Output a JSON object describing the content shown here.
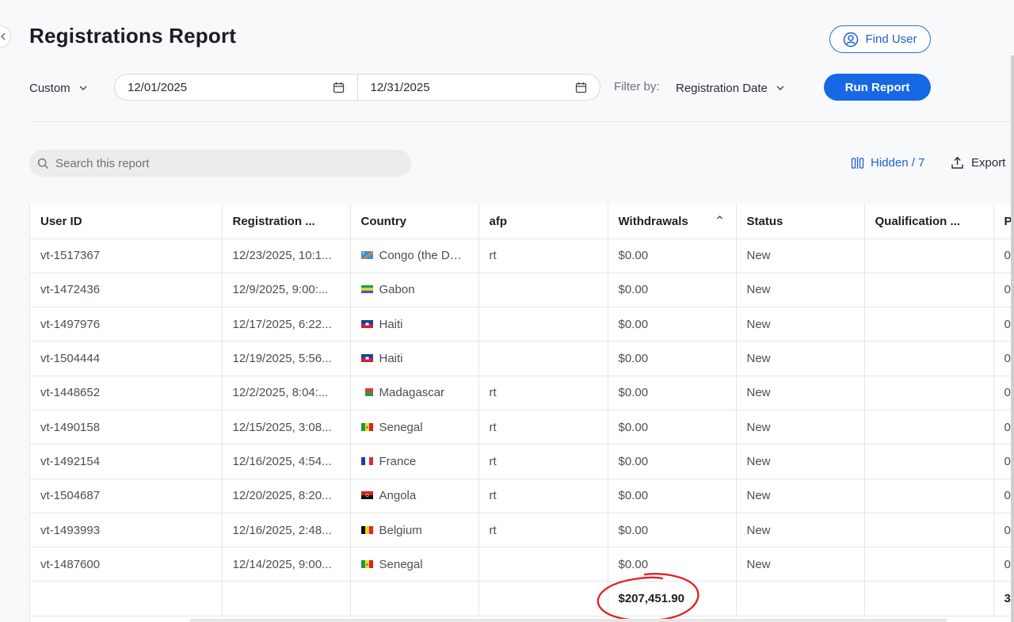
{
  "header": {
    "title": "Registrations Report",
    "find_user_label": "Find User"
  },
  "controls": {
    "range_preset": "Custom",
    "start_date": "12/01/2025",
    "end_date": "12/31/2025",
    "filter_label": "Filter by:",
    "filter_value": "Registration Date",
    "run_label": "Run Report"
  },
  "toolbar": {
    "search_placeholder": "Search this report",
    "hidden_label": "Hidden / 7",
    "export_label": "Export"
  },
  "table": {
    "columns": [
      "User ID",
      "Registration ...",
      "Country",
      "afp",
      "Withdrawals",
      "Status",
      "Qualification ...",
      "P"
    ],
    "sorted_column": "Withdrawals",
    "rows": [
      {
        "id": "vt-1517367",
        "reg": "12/23/2025, 10:1...",
        "flag": "congo-dr",
        "country": "Congo (the Democ",
        "afp": "rt",
        "withdrawals": "$0.00",
        "status": "New",
        "qual": "",
        "p": "0"
      },
      {
        "id": "vt-1472436",
        "reg": "12/9/2025, 9:00:...",
        "flag": "gabon",
        "country": "Gabon",
        "afp": "",
        "withdrawals": "$0.00",
        "status": "New",
        "qual": "",
        "p": "0"
      },
      {
        "id": "vt-1497976",
        "reg": "12/17/2025, 6:22...",
        "flag": "haiti",
        "country": "Haiti",
        "afp": "",
        "withdrawals": "$0.00",
        "status": "New",
        "qual": "",
        "p": "0"
      },
      {
        "id": "vt-1504444",
        "reg": "12/19/2025, 5:56...",
        "flag": "haiti",
        "country": "Haiti",
        "afp": "",
        "withdrawals": "$0.00",
        "status": "New",
        "qual": "",
        "p": "0"
      },
      {
        "id": "vt-1448652",
        "reg": "12/2/2025, 8:04:...",
        "flag": "madagascar",
        "country": "Madagascar",
        "afp": "rt",
        "withdrawals": "$0.00",
        "status": "New",
        "qual": "",
        "p": "0"
      },
      {
        "id": "vt-1490158",
        "reg": "12/15/2025, 3:08...",
        "flag": "senegal",
        "country": "Senegal",
        "afp": "rt",
        "withdrawals": "$0.00",
        "status": "New",
        "qual": "",
        "p": "0"
      },
      {
        "id": "vt-1492154",
        "reg": "12/16/2025, 4:54...",
        "flag": "france",
        "country": "France",
        "afp": "rt",
        "withdrawals": "$0.00",
        "status": "New",
        "qual": "",
        "p": "0"
      },
      {
        "id": "vt-1504687",
        "reg": "12/20/2025, 8:20...",
        "flag": "angola",
        "country": "Angola",
        "afp": "rt",
        "withdrawals": "$0.00",
        "status": "New",
        "qual": "",
        "p": "0"
      },
      {
        "id": "vt-1493993",
        "reg": "12/16/2025, 2:48...",
        "flag": "belgium",
        "country": "Belgium",
        "afp": "rt",
        "withdrawals": "$0.00",
        "status": "New",
        "qual": "",
        "p": "0"
      },
      {
        "id": "vt-1487600",
        "reg": "12/14/2025, 9:00...",
        "flag": "senegal",
        "country": "Senegal",
        "afp": "",
        "withdrawals": "$0.00",
        "status": "New",
        "qual": "",
        "p": "0"
      }
    ],
    "totals": {
      "withdrawals": "$207,451.90",
      "p": "3"
    }
  },
  "colors": {
    "primary": "#1768e5",
    "annotation": "#e02424"
  }
}
